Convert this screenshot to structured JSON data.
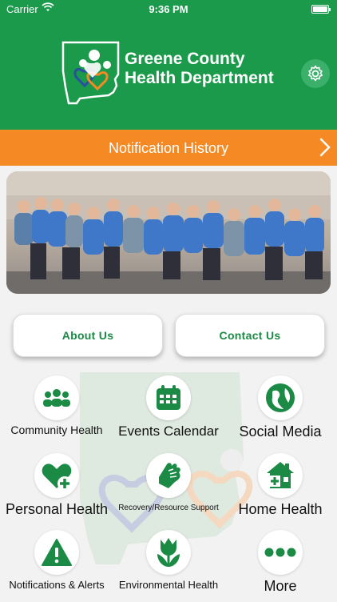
{
  "status_bar": {
    "carrier": "Carrier",
    "time": "9:36 PM"
  },
  "header": {
    "title_line1": "Greene County",
    "title_line2": "Health Department",
    "settings_icon": "gear-icon",
    "accent": "#1a9a4a"
  },
  "notification_bar": {
    "label": "Notification History",
    "color": "#f58a24"
  },
  "buttons": {
    "about": "About Us",
    "contact": "Contact Us"
  },
  "tiles": [
    {
      "label": "Community Health",
      "icon": "people-group-icon"
    },
    {
      "label": "Events Calendar",
      "icon": "calendar-icon"
    },
    {
      "label": "Social Media",
      "icon": "globe-icon"
    },
    {
      "label": "Personal Health",
      "icon": "heart-plus-icon"
    },
    {
      "label": "Recovery/Resource Support",
      "icon": "fist-icon"
    },
    {
      "label": "Home Health",
      "icon": "home-health-icon"
    },
    {
      "label": "Notifications & Alerts",
      "icon": "warning-icon"
    },
    {
      "label": "Environmental Health",
      "icon": "tulip-icon"
    },
    {
      "label": "More",
      "icon": "more-dots-icon"
    }
  ]
}
